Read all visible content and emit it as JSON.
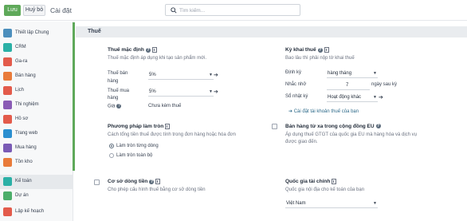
{
  "toolbar": {
    "save_label": "Lưu",
    "discard_label": "Huỷ bỏ",
    "title": "Cài đặt"
  },
  "search": {
    "placeholder": "Tìm kiếm..."
  },
  "sidebar": {
    "items": [
      {
        "label": "Thiết lập Chung",
        "icon": "settings-app-icon",
        "color": "#4c8fbd"
      },
      {
        "label": "CRM",
        "icon": "crm-app-icon",
        "color": "#2bb0a6"
      },
      {
        "label": "Ga-ra",
        "icon": "garage-app-icon",
        "color": "#e35b4b"
      },
      {
        "label": "Bán hàng",
        "icon": "sales-app-icon",
        "color": "#e97b3a"
      },
      {
        "label": "Lịch",
        "icon": "calendar-app-icon",
        "color": "#e35b4b"
      },
      {
        "label": "Thi nghiệm",
        "icon": "lab-app-icon",
        "color": "#8a5bb5"
      },
      {
        "label": "Hồ sơ",
        "icon": "documents-app-icon",
        "color": "#e35b4b"
      },
      {
        "label": "Trang web",
        "icon": "website-app-icon",
        "color": "#2b8fd0"
      },
      {
        "label": "Mua hàng",
        "icon": "purchase-app-icon",
        "color": "#7a5bb5"
      },
      {
        "label": "Tồn kho",
        "icon": "inventory-app-icon",
        "color": "#e97b3a"
      },
      {
        "label": "Kế toán",
        "icon": "accounting-app-icon",
        "color": "#2bb0a6"
      },
      {
        "label": "Dự án",
        "icon": "project-app-icon",
        "color": "#4cae6a"
      },
      {
        "label": "Lập kế hoạch",
        "icon": "planning-app-icon",
        "color": "#e35b4b"
      }
    ],
    "active_index": 10
  },
  "section": {
    "title": "Thuế"
  },
  "default_taxes": {
    "title": "Thuế mặc định",
    "desc": "Thuế mặc định áp dụng khi tạo sản phẩm mới.",
    "sales_label_1": "Thuế bán",
    "sales_label_2": "hàng",
    "sales_value": "5%",
    "purchase_label_1": "Thuế mua",
    "purchase_label_2": "hàng",
    "purchase_value": "5%",
    "price_label": "Giá",
    "price_value": "Chưa kèm thuế"
  },
  "tax_return": {
    "title": "Kỳ khai thuế",
    "desc": "Bao lâu thì phải nộp tờ khai thuế",
    "period_label": "Định kỳ",
    "period_value": "hàng tháng",
    "reminder_label": "Nhắc nhở",
    "reminder_value": "7",
    "reminder_unit": "ngày sau kỳ",
    "journal_label": "Sổ nhật ký",
    "journal_value": "Hoạt động khác",
    "tax_accounts_link": "Cài đặt tài khoản thuế của bạn"
  },
  "rounding": {
    "title": "Phương pháp làm tròn",
    "desc": "Cách tổng tiền thuế được tính trong đơn hàng hoặc hóa đơn",
    "option_1": "Làm tròn từng dòng",
    "option_2": "Làm tròn toàn bộ",
    "selected": 1
  },
  "eu_sales": {
    "title": "Bán hàng từ xa trong cộng đồng EU",
    "desc_1": "Áp dụng thuế GTGT của quốc gia EU mà hàng hóa và dịch vụ",
    "desc_2": "được giao đến.",
    "checked": false
  },
  "cash_basis": {
    "title": "Cơ sở dòng tiền",
    "desc": "Cho phép cấu hình thuế bằng cơ sở dòng tiền",
    "checked": false
  },
  "fiscal_country": {
    "title": "Quốc gia tài chính",
    "desc": "Quốc gia nội địa cho kế toán của bạn",
    "value": "Việt Nam"
  }
}
